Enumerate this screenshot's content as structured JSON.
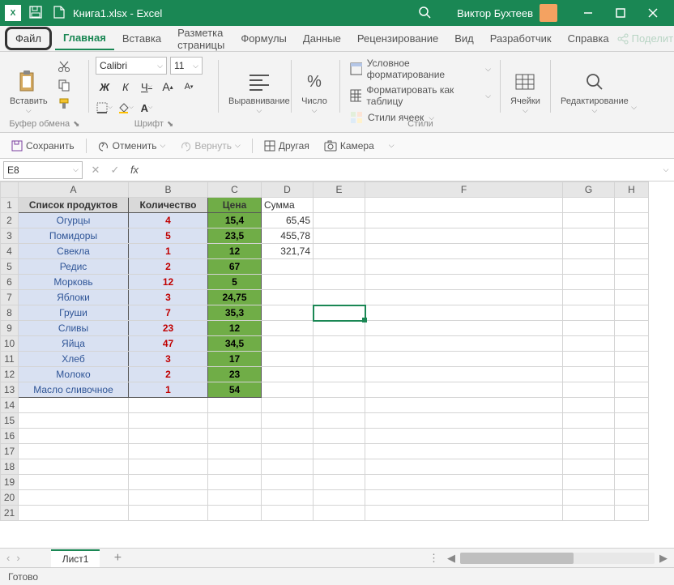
{
  "title_bar": {
    "doc_title": "Книга1.xlsx - Excel",
    "user_name": "Виктор Бухтеев"
  },
  "ribbon_tabs": {
    "file": "Файл",
    "home": "Главная",
    "insert": "Вставка",
    "page_layout": "Разметка страницы",
    "formulas": "Формулы",
    "data": "Данные",
    "review": "Рецензирование",
    "view": "Вид",
    "developer": "Разработчик",
    "help": "Справка",
    "share": "Поделиться"
  },
  "ribbon": {
    "clipboard": {
      "paste": "Вставить",
      "group": "Буфер обмена"
    },
    "font": {
      "name": "Calibri",
      "size": "11",
      "bold": "Ж",
      "italic": "К",
      "underline": "Ч",
      "group": "Шрифт"
    },
    "alignment": {
      "label": "Выравнивание"
    },
    "number": {
      "label": "Число"
    },
    "styles": {
      "conditional": "Условное форматирование",
      "as_table": "Форматировать как таблицу",
      "cell_styles": "Стили ячеек",
      "group": "Стили"
    },
    "cells": {
      "label": "Ячейки"
    },
    "editing": {
      "label": "Редактирование"
    }
  },
  "qat": {
    "save": "Сохранить",
    "undo": "Отменить",
    "redo": "Вернуть",
    "other": "Другая",
    "camera": "Камера"
  },
  "formula_bar": {
    "name_box": "E8"
  },
  "sheet": {
    "cols": [
      "A",
      "B",
      "C",
      "D",
      "E",
      "F",
      "G",
      "H"
    ],
    "headers": {
      "A": "Список продуктов",
      "B": "Количество",
      "C": "Цена",
      "D": "Сумма"
    },
    "rows": [
      {
        "name": "Огурцы",
        "qty": "4",
        "price": "15,4",
        "sum": "65,45"
      },
      {
        "name": "Помидоры",
        "qty": "5",
        "price": "23,5",
        "sum": "455,78"
      },
      {
        "name": "Свекла",
        "qty": "1",
        "price": "12",
        "sum": "321,74"
      },
      {
        "name": "Редис",
        "qty": "2",
        "price": "67",
        "sum": ""
      },
      {
        "name": "Морковь",
        "qty": "12",
        "price": "5",
        "sum": ""
      },
      {
        "name": "Яблоки",
        "qty": "3",
        "price": "24,75",
        "sum": ""
      },
      {
        "name": "Груши",
        "qty": "7",
        "price": "35,3",
        "sum": ""
      },
      {
        "name": "Сливы",
        "qty": "23",
        "price": "12",
        "sum": ""
      },
      {
        "name": "Яйца",
        "qty": "47",
        "price": "34,5",
        "sum": ""
      },
      {
        "name": "Хлеб",
        "qty": "3",
        "price": "17",
        "sum": ""
      },
      {
        "name": "Молоко",
        "qty": "2",
        "price": "23",
        "sum": ""
      },
      {
        "name": "Масло сливочное",
        "qty": "1",
        "price": "54",
        "sum": ""
      }
    ],
    "selected": {
      "row": 8,
      "col": "E"
    }
  },
  "sheet_tabs": {
    "sheet1": "Лист1"
  },
  "status": {
    "ready": "Готово"
  }
}
